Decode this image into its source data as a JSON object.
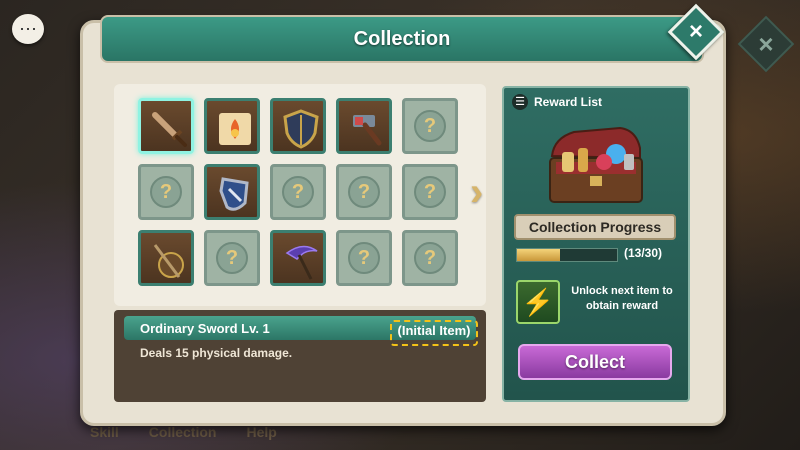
{
  "window": {
    "title": "Collection"
  },
  "bottom_nav": [
    "Skill",
    "Collection",
    "Help"
  ],
  "grid": {
    "slots": [
      {
        "state": "owned",
        "icon": "sword-icon",
        "selected": true
      },
      {
        "state": "owned",
        "icon": "fire-scroll-icon"
      },
      {
        "state": "owned",
        "icon": "shield-icon"
      },
      {
        "state": "owned",
        "icon": "hammer-icon"
      },
      {
        "state": "locked",
        "icon": "question-mark-icon"
      },
      {
        "state": "locked",
        "icon": "question-mark-icon"
      },
      {
        "state": "owned",
        "icon": "blue-shield-icon"
      },
      {
        "state": "locked",
        "icon": "question-mark-icon"
      },
      {
        "state": "locked",
        "icon": "question-mark-icon"
      },
      {
        "state": "locked",
        "icon": "question-mark-icon"
      },
      {
        "state": "owned",
        "icon": "staff-shield-icon"
      },
      {
        "state": "locked",
        "icon": "question-mark-icon"
      },
      {
        "state": "owned",
        "icon": "scythe-icon"
      },
      {
        "state": "locked",
        "icon": "question-mark-icon"
      },
      {
        "state": "locked",
        "icon": "question-mark-icon"
      }
    ],
    "locked_glyph": "?"
  },
  "selected_item": {
    "name": "Ordinary Sword Lv. 1",
    "tag": "(Initial Item)",
    "description": "Deals 15 physical damage."
  },
  "reward": {
    "header": "Reward List",
    "progress_label": "Collection Progress",
    "progress_count": "(13/30)",
    "progress_fraction": 0.433,
    "unlock_text": "Unlock next item to obtain reward",
    "collect_label": "Collect"
  },
  "colors": {
    "accent": "#2d7a6a",
    "collect": "#a64fbb",
    "highlight": "#f3c218"
  }
}
